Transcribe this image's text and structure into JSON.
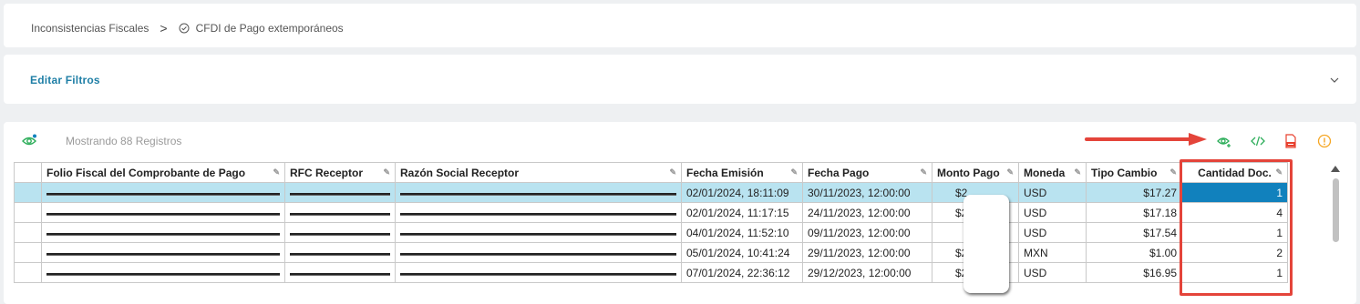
{
  "breadcrumb": {
    "parent": "Inconsistencias Fiscales",
    "separator": ">",
    "current": "CFDI de Pago extemporáneos"
  },
  "filters": {
    "title": "Editar Filtros"
  },
  "toolbar": {
    "records_label": "Mostrando 88 Registros",
    "icons": [
      "view-icon",
      "code-icon",
      "pdf-icon",
      "info-icon"
    ],
    "colors": {
      "view": "#2eae5b",
      "code": "#2eae5b",
      "pdf": "#e8412f",
      "info": "#f5a623",
      "arrow": "#e4443a"
    }
  },
  "table": {
    "columns": [
      "Folio Fiscal del Comprobante de Pago",
      "RFC Receptor",
      "Razón Social Receptor",
      "Fecha Emisión",
      "Fecha Pago",
      "Monto Pago",
      "Moneda",
      "Tipo Cambio",
      "Cantidad Doc."
    ],
    "rows": [
      {
        "fecha_emision": "02/01/2024, 18:11:09",
        "fecha_pago": "30/11/2023, 12:00:00",
        "monto": "$2",
        "moneda": "USD",
        "tipo_cambio": "$17.27",
        "cantidad": "1",
        "selected": true
      },
      {
        "fecha_emision": "02/01/2024, 11:17:15",
        "fecha_pago": "24/11/2023, 12:00:00",
        "monto": "$2",
        "moneda": "USD",
        "tipo_cambio": "$17.18",
        "cantidad": "4",
        "selected": false
      },
      {
        "fecha_emision": "04/01/2024, 11:52:10",
        "fecha_pago": "09/11/2023, 12:00:00",
        "monto": "",
        "moneda": "USD",
        "tipo_cambio": "$17.54",
        "cantidad": "1",
        "selected": false
      },
      {
        "fecha_emision": "05/01/2024, 10:41:24",
        "fecha_pago": "29/11/2023, 12:00:00",
        "monto": "$2",
        "moneda": "MXN",
        "tipo_cambio": "$1.00",
        "cantidad": "2",
        "selected": false
      },
      {
        "fecha_emision": "07/01/2024, 22:36:12",
        "fecha_pago": "29/12/2023, 12:00:00",
        "monto": "$2",
        "moneda": "USD",
        "tipo_cambio": "$16.95",
        "cantidad": "1",
        "selected": false
      }
    ]
  }
}
